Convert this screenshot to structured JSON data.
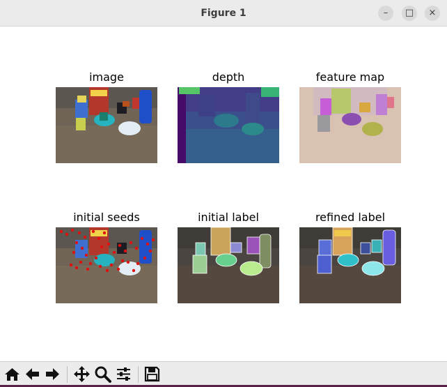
{
  "window": {
    "title": "Figure 1"
  },
  "window_buttons": {
    "minimize": "–",
    "maximize": "□",
    "close": "×"
  },
  "panels": [
    {
      "title": "image"
    },
    {
      "title": "depth"
    },
    {
      "title": "feature map"
    },
    {
      "title": "initial seeds"
    },
    {
      "title": "initial label"
    },
    {
      "title": "refined label"
    }
  ],
  "toolbar": {
    "buttons": [
      {
        "name": "home",
        "icon": "home-icon"
      },
      {
        "name": "back",
        "icon": "arrow-left-icon"
      },
      {
        "name": "forward",
        "icon": "arrow-right-icon"
      },
      {
        "name": "pan",
        "icon": "move-icon"
      },
      {
        "name": "zoom",
        "icon": "magnifier-icon"
      },
      {
        "name": "configure-subplots",
        "icon": "sliders-icon"
      },
      {
        "name": "save",
        "icon": "floppy-disk-icon"
      }
    ]
  },
  "colors": {
    "titlebar": "#ebebeb",
    "toolbar": "#ececec",
    "bottom_edge": "#5a2148"
  }
}
